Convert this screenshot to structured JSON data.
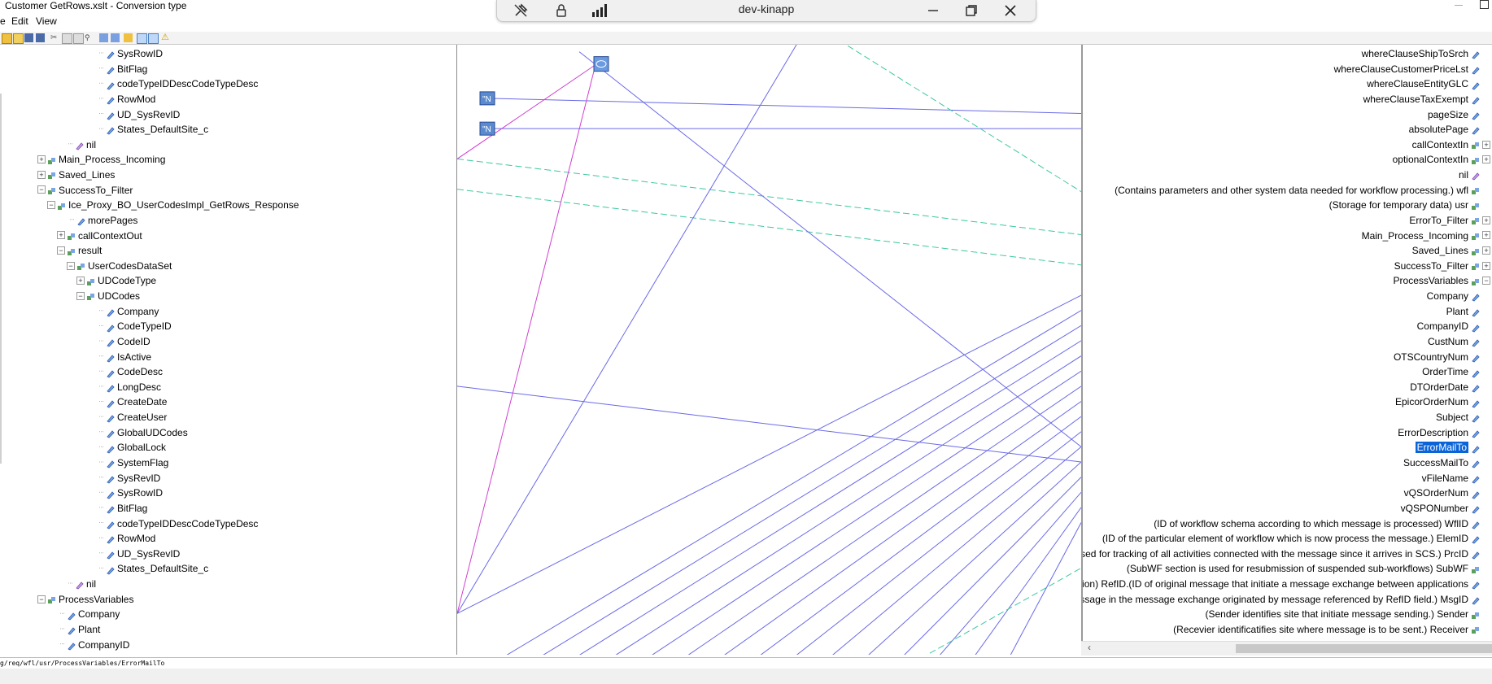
{
  "window": {
    "title": "Customer GetRows.xslt - Conversion type"
  },
  "menu": [
    "e",
    "Edit",
    "View"
  ],
  "remote_bar": {
    "host": "dev-kinapp"
  },
  "status_path": "g/req/wfl/usr/ProcessVariables/ErrorMailTo",
  "left_tree": [
    {
      "label": "SysRowID",
      "indent": 130,
      "kind": "leaf"
    },
    {
      "label": "BitFlag",
      "indent": 130,
      "kind": "leaf"
    },
    {
      "label": "codeTypeIDDescCodeTypeDesc",
      "indent": 130,
      "kind": "leaf"
    },
    {
      "label": "RowMod",
      "indent": 130,
      "kind": "leaf"
    },
    {
      "label": "UD_SysRevID",
      "indent": 130,
      "kind": "leaf"
    },
    {
      "label": "States_DefaultSite_c",
      "indent": 130,
      "kind": "leaf"
    },
    {
      "label": "nil",
      "indent": 92,
      "kind": "nil"
    },
    {
      "label": "Main_Process_Incoming",
      "indent": 58,
      "kind": "node",
      "exp": "+"
    },
    {
      "label": "Saved_Lines",
      "indent": 58,
      "kind": "node",
      "exp": "+"
    },
    {
      "label": "SuccessTo_Filter",
      "indent": 58,
      "kind": "node",
      "exp": "−"
    },
    {
      "label": "Ice_Proxy_BO_UserCodesImpl_GetRows_Response",
      "indent": 70,
      "kind": "node",
      "exp": "−"
    },
    {
      "label": "morePages",
      "indent": 94,
      "kind": "leaf"
    },
    {
      "label": "callContextOut",
      "indent": 82,
      "kind": "node",
      "exp": "+"
    },
    {
      "label": "result",
      "indent": 82,
      "kind": "node",
      "exp": "−"
    },
    {
      "label": "UserCodesDataSet",
      "indent": 94,
      "kind": "node",
      "exp": "−"
    },
    {
      "label": "UDCodeType",
      "indent": 106,
      "kind": "node",
      "exp": "+"
    },
    {
      "label": "UDCodes",
      "indent": 106,
      "kind": "node",
      "exp": "−"
    },
    {
      "label": "Company",
      "indent": 130,
      "kind": "leaf"
    },
    {
      "label": "CodeTypeID",
      "indent": 130,
      "kind": "leaf"
    },
    {
      "label": "CodeID",
      "indent": 130,
      "kind": "leaf"
    },
    {
      "label": "IsActive",
      "indent": 130,
      "kind": "leaf"
    },
    {
      "label": "CodeDesc",
      "indent": 130,
      "kind": "leaf"
    },
    {
      "label": "LongDesc",
      "indent": 130,
      "kind": "leaf"
    },
    {
      "label": "CreateDate",
      "indent": 130,
      "kind": "leaf"
    },
    {
      "label": "CreateUser",
      "indent": 130,
      "kind": "leaf"
    },
    {
      "label": "GlobalUDCodes",
      "indent": 130,
      "kind": "leaf"
    },
    {
      "label": "GlobalLock",
      "indent": 130,
      "kind": "leaf"
    },
    {
      "label": "SystemFlag",
      "indent": 130,
      "kind": "leaf"
    },
    {
      "label": "SysRevID",
      "indent": 130,
      "kind": "leaf"
    },
    {
      "label": "SysRowID",
      "indent": 130,
      "kind": "leaf"
    },
    {
      "label": "BitFlag",
      "indent": 130,
      "kind": "leaf"
    },
    {
      "label": "codeTypeIDDescCodeTypeDesc",
      "indent": 130,
      "kind": "leaf"
    },
    {
      "label": "RowMod",
      "indent": 130,
      "kind": "leaf"
    },
    {
      "label": "UD_SysRevID",
      "indent": 130,
      "kind": "leaf"
    },
    {
      "label": "States_DefaultSite_c",
      "indent": 130,
      "kind": "leaf"
    },
    {
      "label": "nil",
      "indent": 92,
      "kind": "nil"
    },
    {
      "label": "ProcessVariables",
      "indent": 58,
      "kind": "node",
      "exp": "−"
    },
    {
      "label": "Company",
      "indent": 82,
      "kind": "leaf"
    },
    {
      "label": "Plant",
      "indent": 82,
      "kind": "leaf"
    },
    {
      "label": "CompanyID",
      "indent": 82,
      "kind": "leaf"
    }
  ],
  "right_tree": [
    {
      "label": "whereClauseShipToSrch",
      "kind": "leaf"
    },
    {
      "label": "whereClauseCustomerPriceLst",
      "kind": "leaf"
    },
    {
      "label": "whereClauseEntityGLC",
      "kind": "leaf"
    },
    {
      "label": "whereClauseTaxExempt",
      "kind": "leaf"
    },
    {
      "label": "pageSize",
      "kind": "leaf"
    },
    {
      "label": "absolutePage",
      "kind": "leaf"
    },
    {
      "label": "callContextIn",
      "kind": "node",
      "exp": "+"
    },
    {
      "label": "optionalContextIn",
      "kind": "node",
      "exp": "+"
    },
    {
      "label": "nil",
      "kind": "nil"
    },
    {
      "label": "(Contains parameters and other system data needed for workflow processing.) wfl",
      "kind": "node"
    },
    {
      "label": "(Storage for temporary data) usr",
      "kind": "node"
    },
    {
      "label": "ErrorTo_Filter",
      "kind": "node",
      "exp": "+"
    },
    {
      "label": "Main_Process_Incoming",
      "kind": "node",
      "exp": "+"
    },
    {
      "label": "Saved_Lines",
      "kind": "node",
      "exp": "+"
    },
    {
      "label": "SuccessTo_Filter",
      "kind": "node",
      "exp": "+"
    },
    {
      "label": "ProcessVariables",
      "kind": "node",
      "exp": "−"
    },
    {
      "label": "Company",
      "kind": "leaf"
    },
    {
      "label": "Plant",
      "kind": "leaf"
    },
    {
      "label": "CompanyID",
      "kind": "leaf"
    },
    {
      "label": "CustNum",
      "kind": "leaf"
    },
    {
      "label": "OTSCountryNum",
      "kind": "leaf"
    },
    {
      "label": "OrderTime",
      "kind": "leaf"
    },
    {
      "label": "DTOrderDate",
      "kind": "leaf"
    },
    {
      "label": "EpicorOrderNum",
      "kind": "leaf"
    },
    {
      "label": "Subject",
      "kind": "leaf"
    },
    {
      "label": "ErrorDescription",
      "kind": "leaf"
    },
    {
      "label": "ErrorMailTo",
      "kind": "leaf",
      "selected": true
    },
    {
      "label": "SuccessMailTo",
      "kind": "leaf"
    },
    {
      "label": "vFileName",
      "kind": "leaf"
    },
    {
      "label": "vQSOrderNum",
      "kind": "leaf"
    },
    {
      "label": "vQSPONumber",
      "kind": "leaf"
    },
    {
      "label": "(ID of workflow schema according to which message is processed) WflID",
      "kind": "leaf"
    },
    {
      "label": "(ID of the particular element of workflow which is now process the message.) ElemID",
      "kind": "leaf"
    },
    {
      "label": "ID used for tracking of all activities connected with the message since it arrives in SCS.) PrcID",
      "kind": "leaf"
    },
    {
      "label": "(SubWF section is used for resubmission of suspended sub-workflows) SubWF",
      "kind": "node"
    },
    {
      "label": "lication) RefID.(ID of original message that initiate a message exchange between applications",
      "kind": "leaf"
    },
    {
      "label": "message in the message exchange originated by message referenced by RefID field.) MsgID",
      "kind": "leaf"
    },
    {
      "label": "(Sender identifies site that initiate message sending.) Sender",
      "kind": "node"
    },
    {
      "label": "(Recevier identificatifies site where message is to be sent.) Receiver",
      "kind": "node"
    }
  ],
  "mid_nodes": [
    {
      "label": "\"N"
    },
    {
      "label": "\"N"
    }
  ],
  "colors": {
    "map_line": "#6a6ae8",
    "pink_line": "#d040d0",
    "dashed_line": "#3cc8a0",
    "selection": "#0a64d8",
    "node_icon": "#4a90d9"
  }
}
